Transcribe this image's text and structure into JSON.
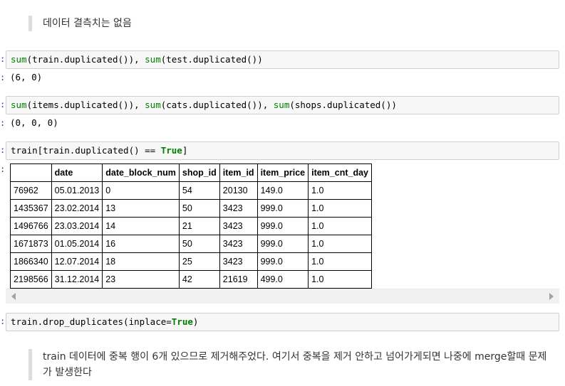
{
  "markdown_top": "데이터 결측치는 없음",
  "cells": [
    {
      "prompt": ":",
      "code": [
        {
          "t": "sum",
          "c": "fn"
        },
        {
          "t": "(train.duplicated()), ",
          "c": ""
        },
        {
          "t": "sum",
          "c": "fn"
        },
        {
          "t": "(test.duplicated())",
          "c": ""
        }
      ],
      "output_prompt": ":",
      "output": "(6, 0)"
    },
    {
      "prompt": ":",
      "code": [
        {
          "t": "sum",
          "c": "fn"
        },
        {
          "t": "(items.duplicated()), ",
          "c": ""
        },
        {
          "t": "sum",
          "c": "fn"
        },
        {
          "t": "(cats.duplicated()), ",
          "c": ""
        },
        {
          "t": "sum",
          "c": "fn"
        },
        {
          "t": "(shops.duplicated())",
          "c": ""
        }
      ],
      "output_prompt": ":",
      "output": "(0, 0, 0)"
    },
    {
      "prompt": ":",
      "code": [
        {
          "t": "train[train.duplicated() == ",
          "c": ""
        },
        {
          "t": "True",
          "c": "kw"
        },
        {
          "t": "]",
          "c": ""
        }
      ],
      "output_prompt": ":"
    },
    {
      "prompt": ":",
      "code": [
        {
          "t": "train.drop_duplicates(inplace=",
          "c": ""
        },
        {
          "t": "True",
          "c": "kw"
        },
        {
          "t": ")",
          "c": ""
        }
      ]
    }
  ],
  "table": {
    "columns": [
      "",
      "date",
      "date_block_num",
      "shop_id",
      "item_id",
      "item_price",
      "item_cnt_day"
    ],
    "rows": [
      [
        "76962",
        "05.01.2013",
        "0",
        "54",
        "20130",
        "149.0",
        "1.0"
      ],
      [
        "1435367",
        "23.02.2014",
        "13",
        "50",
        "3423",
        "999.0",
        "1.0"
      ],
      [
        "1496766",
        "23.03.2014",
        "14",
        "21",
        "3423",
        "999.0",
        "1.0"
      ],
      [
        "1671873",
        "01.05.2014",
        "16",
        "50",
        "3423",
        "999.0",
        "1.0"
      ],
      [
        "1866340",
        "12.07.2014",
        "18",
        "25",
        "3423",
        "999.0",
        "1.0"
      ],
      [
        "2198566",
        "31.12.2014",
        "23",
        "42",
        "21619",
        "499.0",
        "1.0"
      ]
    ]
  },
  "markdown_bottom": "train 데이터에 중복 행이 6개 있으므로 제거해주었다. 여기서 중복을 제거 안하고 넘어가게되면 나중에 merge할때 문제가 발생한다"
}
